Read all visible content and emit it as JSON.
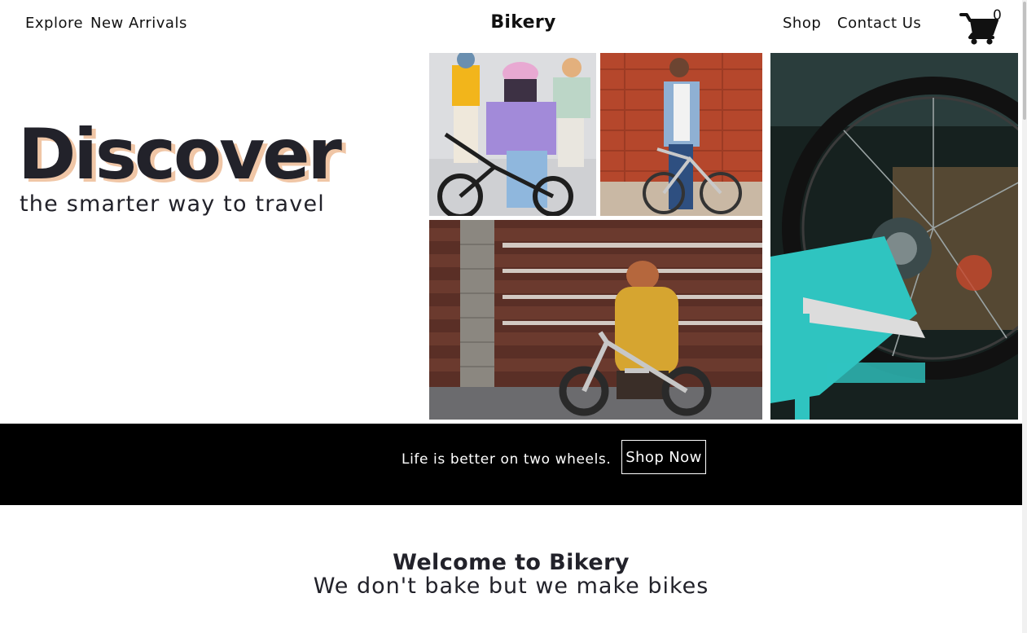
{
  "nav": {
    "explore": "Explore",
    "new_arrivals": "New Arrivals",
    "brand": "Bikery",
    "shop": "Shop",
    "contact": "Contact Us",
    "cart_icon": "cart-icon",
    "cart_count": "0"
  },
  "hero": {
    "title": "Discover",
    "subtitle": "the smarter way to travel"
  },
  "banner": {
    "text": "Life is better on two wheels.",
    "button": "Shop Now"
  },
  "welcome": {
    "title": "Welcome to Bikery",
    "subtitle": "We don't bake but we make bikes"
  },
  "colors": {
    "text_dark": "#22222a",
    "title_shadow": "#f0c6a6",
    "banner_bg": "#000000",
    "banner_text": "#ffffff",
    "bike_teal": "#2fc4c0"
  }
}
